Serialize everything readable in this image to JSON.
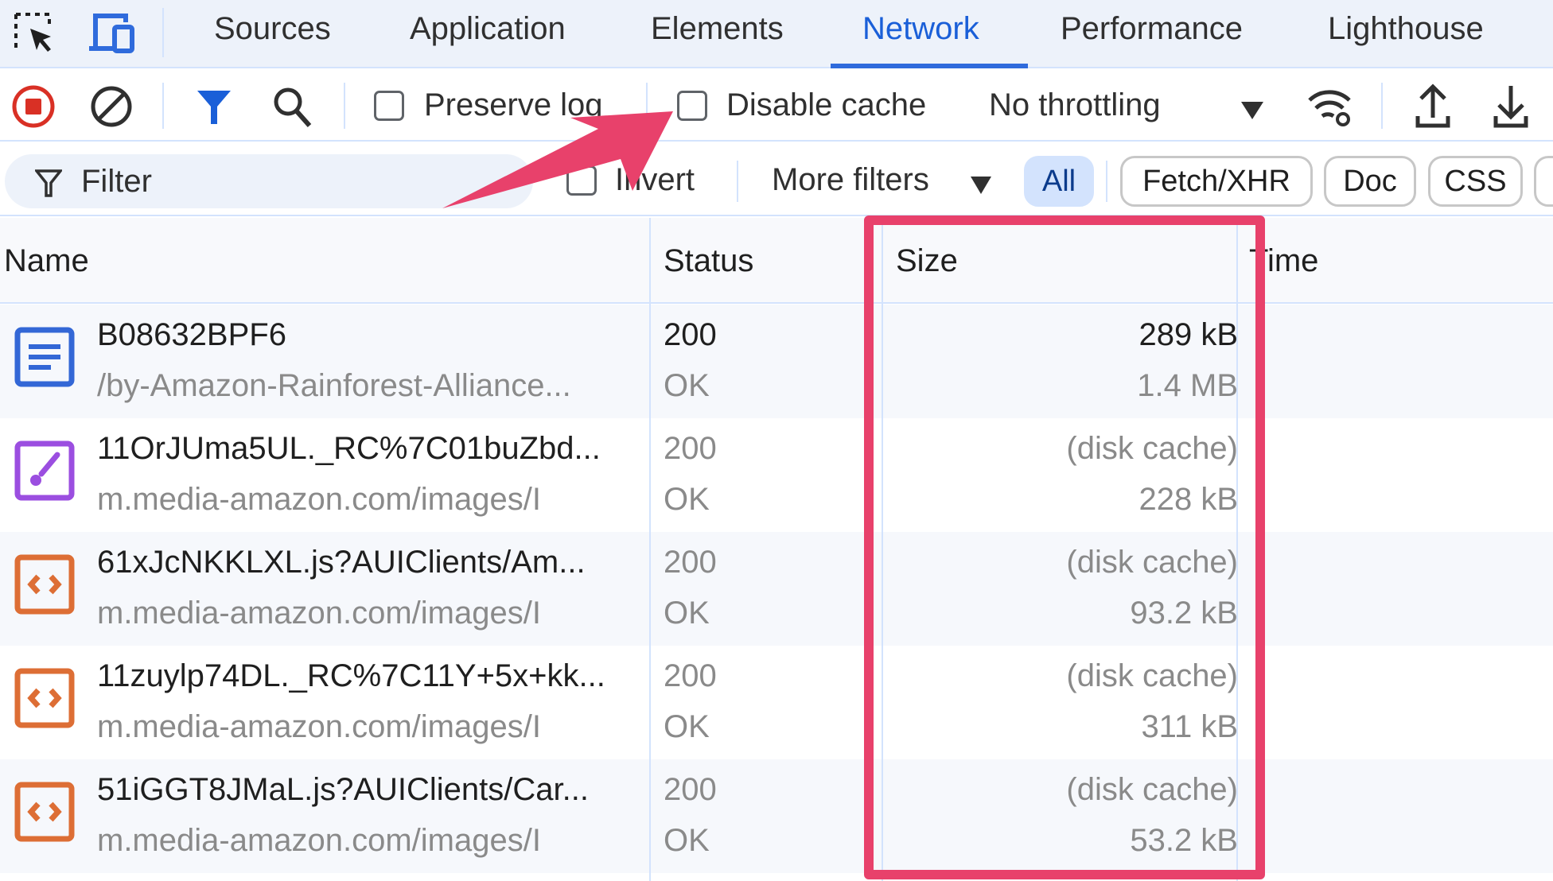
{
  "tabs": [
    {
      "label": "Sources"
    },
    {
      "label": "Application"
    },
    {
      "label": "Elements"
    },
    {
      "label": "Network",
      "active": true
    },
    {
      "label": "Performance"
    },
    {
      "label": "Lighthouse"
    }
  ],
  "toolbar": {
    "preserve_log": "Preserve log",
    "preserve_log_checked": false,
    "disable_cache": "Disable cache",
    "disable_cache_checked": false,
    "throttling": "No throttling"
  },
  "filterbar": {
    "filter_placeholder": "Filter",
    "invert": "Invert",
    "more_filters": "More filters",
    "chips": [
      "All",
      "Fetch/XHR",
      "Doc",
      "CSS"
    ],
    "active_chip": "All"
  },
  "table": {
    "columns": [
      "Name",
      "Status",
      "Size",
      "Time"
    ],
    "rows": [
      {
        "type": "document",
        "name": "B08632BPF6",
        "path": "/by-Amazon-Rainforest-Alliance...",
        "status": "200",
        "status_text": "OK",
        "size": "289 kB",
        "resource": "1.4 MB"
      },
      {
        "type": "stylesheet",
        "name": "11OrJUma5UL._RC%7C01buZbd...",
        "path": "m.media-amazon.com/images/I",
        "status": "200",
        "status_text": "OK",
        "size": "(disk cache)",
        "resource": "228 kB"
      },
      {
        "type": "script",
        "name": "61xJcNKKLXL.js?AUIClients/Am...",
        "path": "m.media-amazon.com/images/I",
        "status": "200",
        "status_text": "OK",
        "size": "(disk cache)",
        "resource": "93.2 kB"
      },
      {
        "type": "script",
        "name": "11zuylp74DL._RC%7C11Y+5x+kk...",
        "path": "m.media-amazon.com/images/I",
        "status": "200",
        "status_text": "OK",
        "size": "(disk cache)",
        "resource": "311 kB"
      },
      {
        "type": "script",
        "name": "51iGGT8JMaL.js?AUIClients/Car...",
        "path": "m.media-amazon.com/images/I",
        "status": "200",
        "status_text": "OK",
        "size": "(disk cache)",
        "resource": "53.2 kB"
      }
    ]
  },
  "colors": {
    "accent": "#1a5fd8",
    "annotation": "#e8416b",
    "record": "#d93025",
    "document": "#3367d6",
    "stylesheet": "#9b4ee0",
    "script": "#dd6e35"
  }
}
